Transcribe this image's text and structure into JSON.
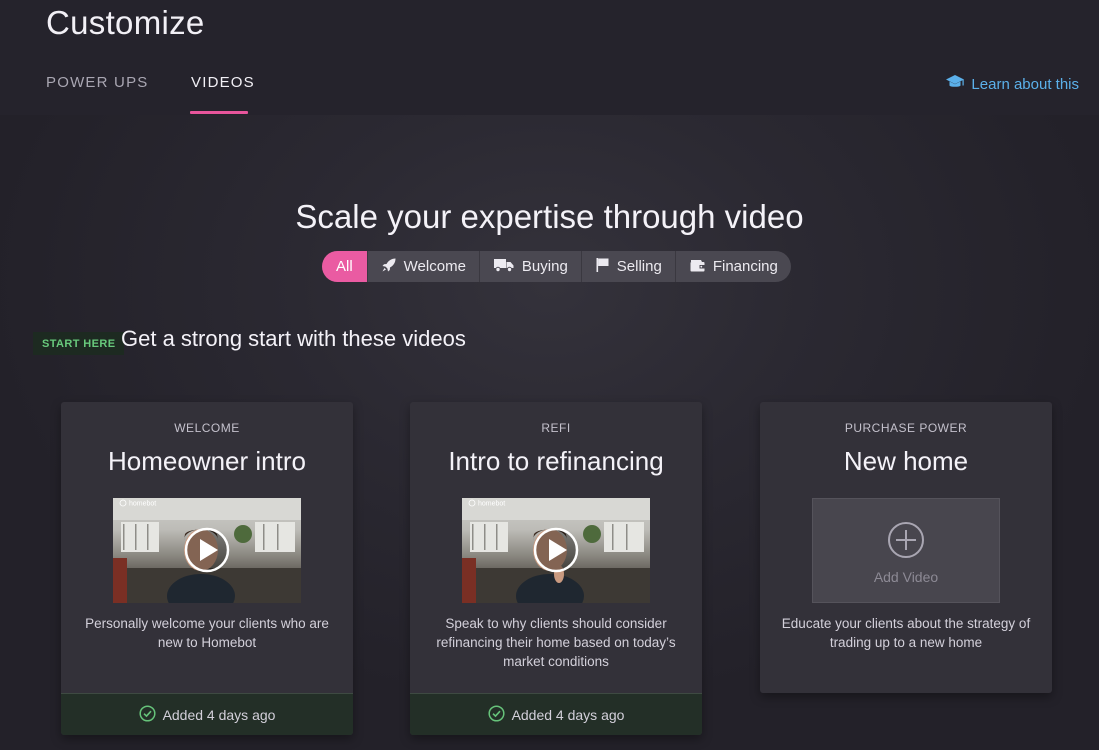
{
  "header": {
    "title": "Customize",
    "tabs": [
      {
        "label": "POWER UPS"
      },
      {
        "label": "VIDEOS"
      }
    ],
    "learn_link": "Learn about this",
    "accent": "#e8559c",
    "link_color": "#5bb0ea"
  },
  "hero": {
    "title": "Scale your expertise through video",
    "filters": [
      {
        "label": "All",
        "icon": null,
        "active": true
      },
      {
        "label": "Welcome",
        "icon": "rocket-icon",
        "active": false
      },
      {
        "label": "Buying",
        "icon": "truck-icon",
        "active": false
      },
      {
        "label": "Selling",
        "icon": "flag-icon",
        "active": false
      },
      {
        "label": "Financing",
        "icon": "wallet-icon",
        "active": false
      }
    ]
  },
  "section": {
    "badge": "START HERE",
    "title": "Get a strong start with these videos"
  },
  "cards": [
    {
      "category": "WELCOME",
      "title": "Homeowner intro",
      "thumbnail_brand": "homebot",
      "description": "Personally welcome your clients who are new to Homebot",
      "status": "Added 4 days ago"
    },
    {
      "category": "REFI",
      "title": "Intro to refinancing",
      "thumbnail_brand": "homebot",
      "description": "Speak to why clients should consider refinancing their home based on today’s market conditions",
      "status": "Added 4 days ago"
    },
    {
      "category": "PURCHASE POWER",
      "title": "New home",
      "add_label": "Add Video",
      "description": "Educate your clients about the strategy of trading up to a new home"
    }
  ]
}
